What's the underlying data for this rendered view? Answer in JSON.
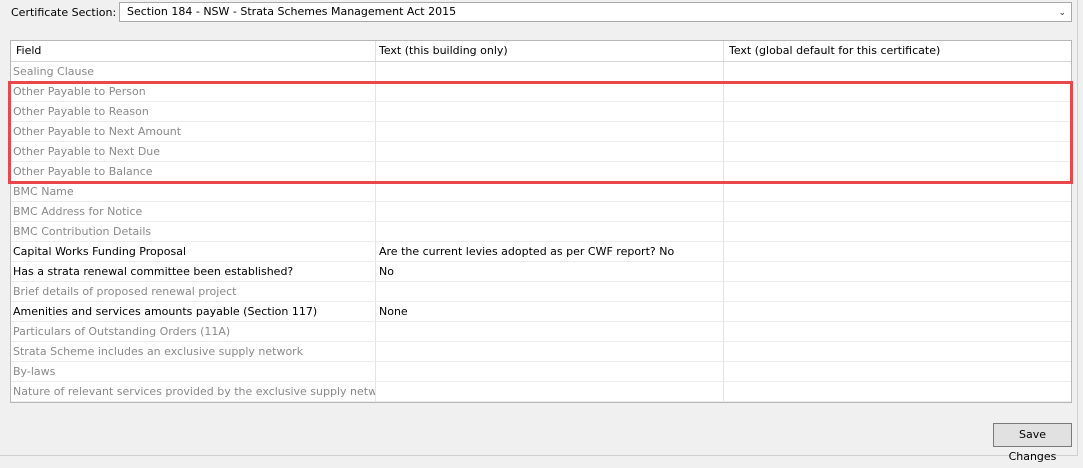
{
  "certificate": {
    "label": "Certificate Section:",
    "selected": "Section 184 - NSW - Strata Schemes Management Act 2015"
  },
  "table": {
    "columns": [
      "Field",
      "Text (this building only)",
      "Text (global default for this certificate)"
    ],
    "rows": [
      {
        "field": "Sealing Clause",
        "building": "",
        "global": "",
        "enabled": false
      },
      {
        "field": "Other Payable to Person",
        "building": "",
        "global": "",
        "enabled": false
      },
      {
        "field": "Other Payable to Reason",
        "building": "",
        "global": "",
        "enabled": false
      },
      {
        "field": "Other Payable to Next Amount",
        "building": "",
        "global": "",
        "enabled": false
      },
      {
        "field": "Other Payable to Next Due",
        "building": "",
        "global": "",
        "enabled": false
      },
      {
        "field": "Other Payable to Balance",
        "building": "",
        "global": "",
        "enabled": false
      },
      {
        "field": "BMC Name",
        "building": "",
        "global": "",
        "enabled": false
      },
      {
        "field": "BMC Address for Notice",
        "building": "",
        "global": "",
        "enabled": false
      },
      {
        "field": "BMC Contribution Details",
        "building": "",
        "global": "",
        "enabled": false
      },
      {
        "field": "Capital Works Funding Proposal",
        "building": "Are the current levies adopted as per CWF report? No",
        "global": "",
        "enabled": true
      },
      {
        "field": "Has a strata renewal committee been established?",
        "building": "No",
        "global": "",
        "enabled": true
      },
      {
        "field": "Brief details of proposed renewal project",
        "building": "",
        "global": "",
        "enabled": false
      },
      {
        "field": "Amenities and services amounts payable (Section 117)",
        "building": "None",
        "global": "",
        "enabled": true
      },
      {
        "field": "Particulars of Outstanding Orders (11A)",
        "building": "",
        "global": "",
        "enabled": false
      },
      {
        "field": "Strata Scheme includes an exclusive supply network",
        "building": "",
        "global": "",
        "enabled": false
      },
      {
        "field": "By-laws",
        "building": "",
        "global": "",
        "enabled": false
      },
      {
        "field": "Nature of relevant services provided by the exclusive supply network",
        "building": "",
        "global": "",
        "enabled": false
      }
    ]
  },
  "buttons": {
    "save_label": "Save Changes"
  },
  "colors": {
    "highlight": "#e8474b",
    "disabled_text": "#8a8a8a"
  }
}
